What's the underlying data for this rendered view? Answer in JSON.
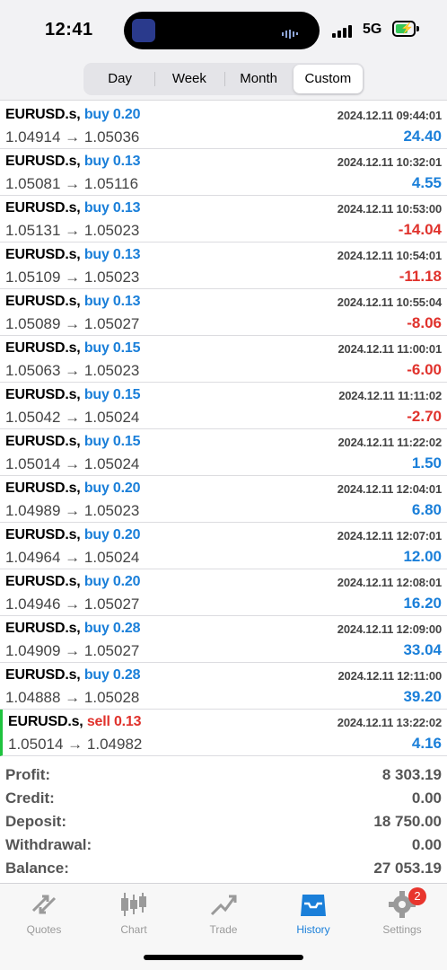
{
  "status": {
    "time": "12:41",
    "network": "5G"
  },
  "tabs": {
    "day": "Day",
    "week": "Week",
    "month": "Month",
    "custom": "Custom",
    "active": "custom"
  },
  "trades": [
    {
      "symbol": "EURUSD.s,",
      "side": "buy",
      "volume": "0.20",
      "date": "2024.12.11 09:44:01",
      "prices": "1.04914 → 1.05036",
      "profit": "24.40"
    },
    {
      "symbol": "EURUSD.s,",
      "side": "buy",
      "volume": "0.13",
      "date": "2024.12.11 10:32:01",
      "prices": "1.05081 → 1.05116",
      "profit": "4.55"
    },
    {
      "symbol": "EURUSD.s,",
      "side": "buy",
      "volume": "0.13",
      "date": "2024.12.11 10:53:00",
      "prices": "1.05131 → 1.05023",
      "profit": "-14.04"
    },
    {
      "symbol": "EURUSD.s,",
      "side": "buy",
      "volume": "0.13",
      "date": "2024.12.11 10:54:01",
      "prices": "1.05109 → 1.05023",
      "profit": "-11.18"
    },
    {
      "symbol": "EURUSD.s,",
      "side": "buy",
      "volume": "0.13",
      "date": "2024.12.11 10:55:04",
      "prices": "1.05089 → 1.05027",
      "profit": "-8.06"
    },
    {
      "symbol": "EURUSD.s,",
      "side": "buy",
      "volume": "0.15",
      "date": "2024.12.11 11:00:01",
      "prices": "1.05063 → 1.05023",
      "profit": "-6.00"
    },
    {
      "symbol": "EURUSD.s,",
      "side": "buy",
      "volume": "0.15",
      "date": "2024.12.11 11:11:02",
      "prices": "1.05042 → 1.05024",
      "profit": "-2.70"
    },
    {
      "symbol": "EURUSD.s,",
      "side": "buy",
      "volume": "0.15",
      "date": "2024.12.11 11:22:02",
      "prices": "1.05014 → 1.05024",
      "profit": "1.50"
    },
    {
      "symbol": "EURUSD.s,",
      "side": "buy",
      "volume": "0.20",
      "date": "2024.12.11 12:04:01",
      "prices": "1.04989 → 1.05023",
      "profit": "6.80"
    },
    {
      "symbol": "EURUSD.s,",
      "side": "buy",
      "volume": "0.20",
      "date": "2024.12.11 12:07:01",
      "prices": "1.04964 → 1.05024",
      "profit": "12.00"
    },
    {
      "symbol": "EURUSD.s,",
      "side": "buy",
      "volume": "0.20",
      "date": "2024.12.11 12:08:01",
      "prices": "1.04946 → 1.05027",
      "profit": "16.20"
    },
    {
      "symbol": "EURUSD.s,",
      "side": "buy",
      "volume": "0.28",
      "date": "2024.12.11 12:09:00",
      "prices": "1.04909 → 1.05027",
      "profit": "33.04"
    },
    {
      "symbol": "EURUSD.s,",
      "side": "buy",
      "volume": "0.28",
      "date": "2024.12.11 12:11:00",
      "prices": "1.04888 → 1.05028",
      "profit": "39.20"
    },
    {
      "symbol": "EURUSD.s,",
      "side": "sell",
      "volume": "0.13",
      "date": "2024.12.11 13:22:02",
      "prices": "1.05014 → 1.04982",
      "profit": "4.16"
    }
  ],
  "summary": {
    "profit_label": "Profit:",
    "profit": "8 303.19",
    "credit_label": "Credit:",
    "credit": "0.00",
    "deposit_label": "Deposit:",
    "deposit": "18 750.00",
    "withdrawal_label": "Withdrawal:",
    "withdrawal": "0.00",
    "balance_label": "Balance:",
    "balance": "27 053.19"
  },
  "tabbar": {
    "quotes": "Quotes",
    "chart": "Chart",
    "trade": "Trade",
    "history": "History",
    "settings": "Settings",
    "settings_badge": "2",
    "active": "history"
  },
  "colors": {
    "buy": "#1a7fd9",
    "sell": "#e0322c",
    "positive": "#1a7fd9",
    "negative": "#e0322c",
    "accent": "#1a7fd9"
  },
  "icons": {
    "quotes": "arrows-icon",
    "chart": "candlestick-icon",
    "trade": "trend-icon",
    "history": "inbox-icon",
    "settings": "gear-icon"
  }
}
